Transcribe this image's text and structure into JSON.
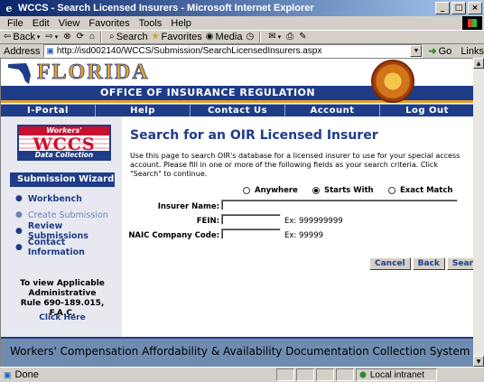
{
  "window": {
    "title": "WCCS - Search Licensed Insurers - Microsoft Internet Explorer"
  },
  "menu": [
    "File",
    "Edit",
    "View",
    "Favorites",
    "Tools",
    "Help"
  ],
  "toolbar": {
    "back": "Back",
    "search": "Search",
    "favorites": "Favorites",
    "media": "Media"
  },
  "address": {
    "label": "Address",
    "url": "http://isd002140/WCCS/Submission/SearchLicensedInsurers.aspx",
    "go": "Go",
    "links": "Links"
  },
  "banner": {
    "state": "FLORIDA",
    "office": "OFFICE OF INSURANCE REGULATION"
  },
  "nav": [
    "I-Portal",
    "Help",
    "Contact Us",
    "Account",
    "Log Out"
  ],
  "logo": {
    "top": "Workers' Compensation",
    "mid": "WCCS",
    "bottom": "Data Collection"
  },
  "wizard": {
    "title": "Submission Wizard",
    "items": [
      {
        "label": "Workbench"
      },
      {
        "label": "Create Submission"
      },
      {
        "label": "Review Submissions"
      },
      {
        "label": "Contact Information"
      }
    ]
  },
  "rule": {
    "text1": "To view Applicable",
    "text2": "Administrative",
    "text3": "Rule 690-189.015, F.A.C.",
    "link": "Click Here"
  },
  "main": {
    "heading": "Search for an OIR Licensed Insurer",
    "intro": "Use this page to search OIR's database for a licensed insurer to use for your special access account.  Please fill in one or more of the following fields as your search criteria. Click \"Search\" to continue.",
    "radios": [
      {
        "label": "Anywhere",
        "selected": false
      },
      {
        "label": "Starts With",
        "selected": true
      },
      {
        "label": "Exact Match",
        "selected": false
      }
    ],
    "fields": {
      "insurer_label": "Insurer Name:",
      "insurer_value": "",
      "fein_label": "FEIN:",
      "fein_value": "",
      "fein_hint": "Ex: 999999999",
      "naic_label": "NAIC Company Code:",
      "naic_value": "",
      "naic_hint": "Ex: 99999"
    },
    "buttons": {
      "cancel": "Cancel",
      "back": "Back",
      "search": "Search"
    }
  },
  "footer": {
    "text": "Workers' Compensation Affordability & Availability Documentation Collection System"
  },
  "status": {
    "left": "Done",
    "zone": "Local intranet"
  }
}
